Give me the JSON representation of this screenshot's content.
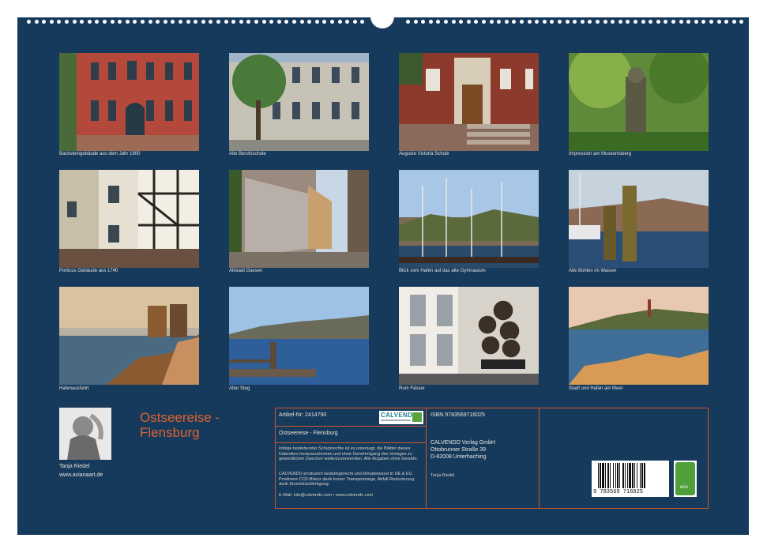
{
  "photos": [
    {
      "caption": "Backsteingebäude aus dem Jahr 1900",
      "subject": "red-brick-building"
    },
    {
      "caption": "Alte Berufsschule",
      "subject": "old-vocational-school"
    },
    {
      "caption": "Auguste Victoria Schule",
      "subject": "school-portal"
    },
    {
      "caption": "Impression am Museumsberg",
      "subject": "garden-statue"
    },
    {
      "caption": "Porticus Gebäude aus 1740",
      "subject": "half-timbered-house"
    },
    {
      "caption": "Altstadt Gassen",
      "subject": "old-town-alley"
    },
    {
      "caption": "Blick vom Hafen auf das alte Gymnasium",
      "subject": "harbour-masts"
    },
    {
      "caption": "Alte Bohlen im Wasser",
      "subject": "wooden-piles"
    },
    {
      "caption": "Hafenausfahrt",
      "subject": "harbour-exit"
    },
    {
      "caption": "Alter Steg",
      "subject": "old-jetty"
    },
    {
      "caption": "Rum Fässer",
      "subject": "rum-barrels"
    },
    {
      "caption": "Stadt und Hafen am Meer",
      "subject": "city-seaside"
    }
  ],
  "author": {
    "name": "Tanja Riedel",
    "website": "www.avianaart.de"
  },
  "title_line1": "Ostseereise -",
  "title_line2": "Flensburg",
  "info": {
    "article_no": "Artikel-Nr: 2414790",
    "calendar_title": "Ostseereise - Flensburg",
    "brand": "CALVENDO",
    "legal_1": "Infolge bestehender Schutzrechte ist es untersagt, die Blätter dieses Kalenders herauszutrennen und ohne Genehmigung des Verlages zu gewerblichen Zwecken weiterzuverwenden. Alle Angaben ohne Gewähr.",
    "legal_2": "CALVENDO produziert bedarfsgerecht und klimabewusst in DE & EU. Positivere CO2-Bilanz dank kurzer Transportwege, Abfall-Reduzierung dank Einzelstückfertigung.",
    "contact": "E-Mail: info@calvendo.com • www.calvendo.com",
    "isbn": "ISBN 9783569716025",
    "publisher_name": "CALVENDO Verlag GmbH",
    "publisher_street": "Ottobrunner Straße 39",
    "publisher_city": "D-82008 Unterhaching",
    "photographer": "Tanja Riedel",
    "barcode_digits": "9 783569 716025",
    "eco_label": "eco"
  },
  "colors": {
    "background": "#163a5c",
    "accent": "#e0632c",
    "rule": "#d2552a"
  }
}
